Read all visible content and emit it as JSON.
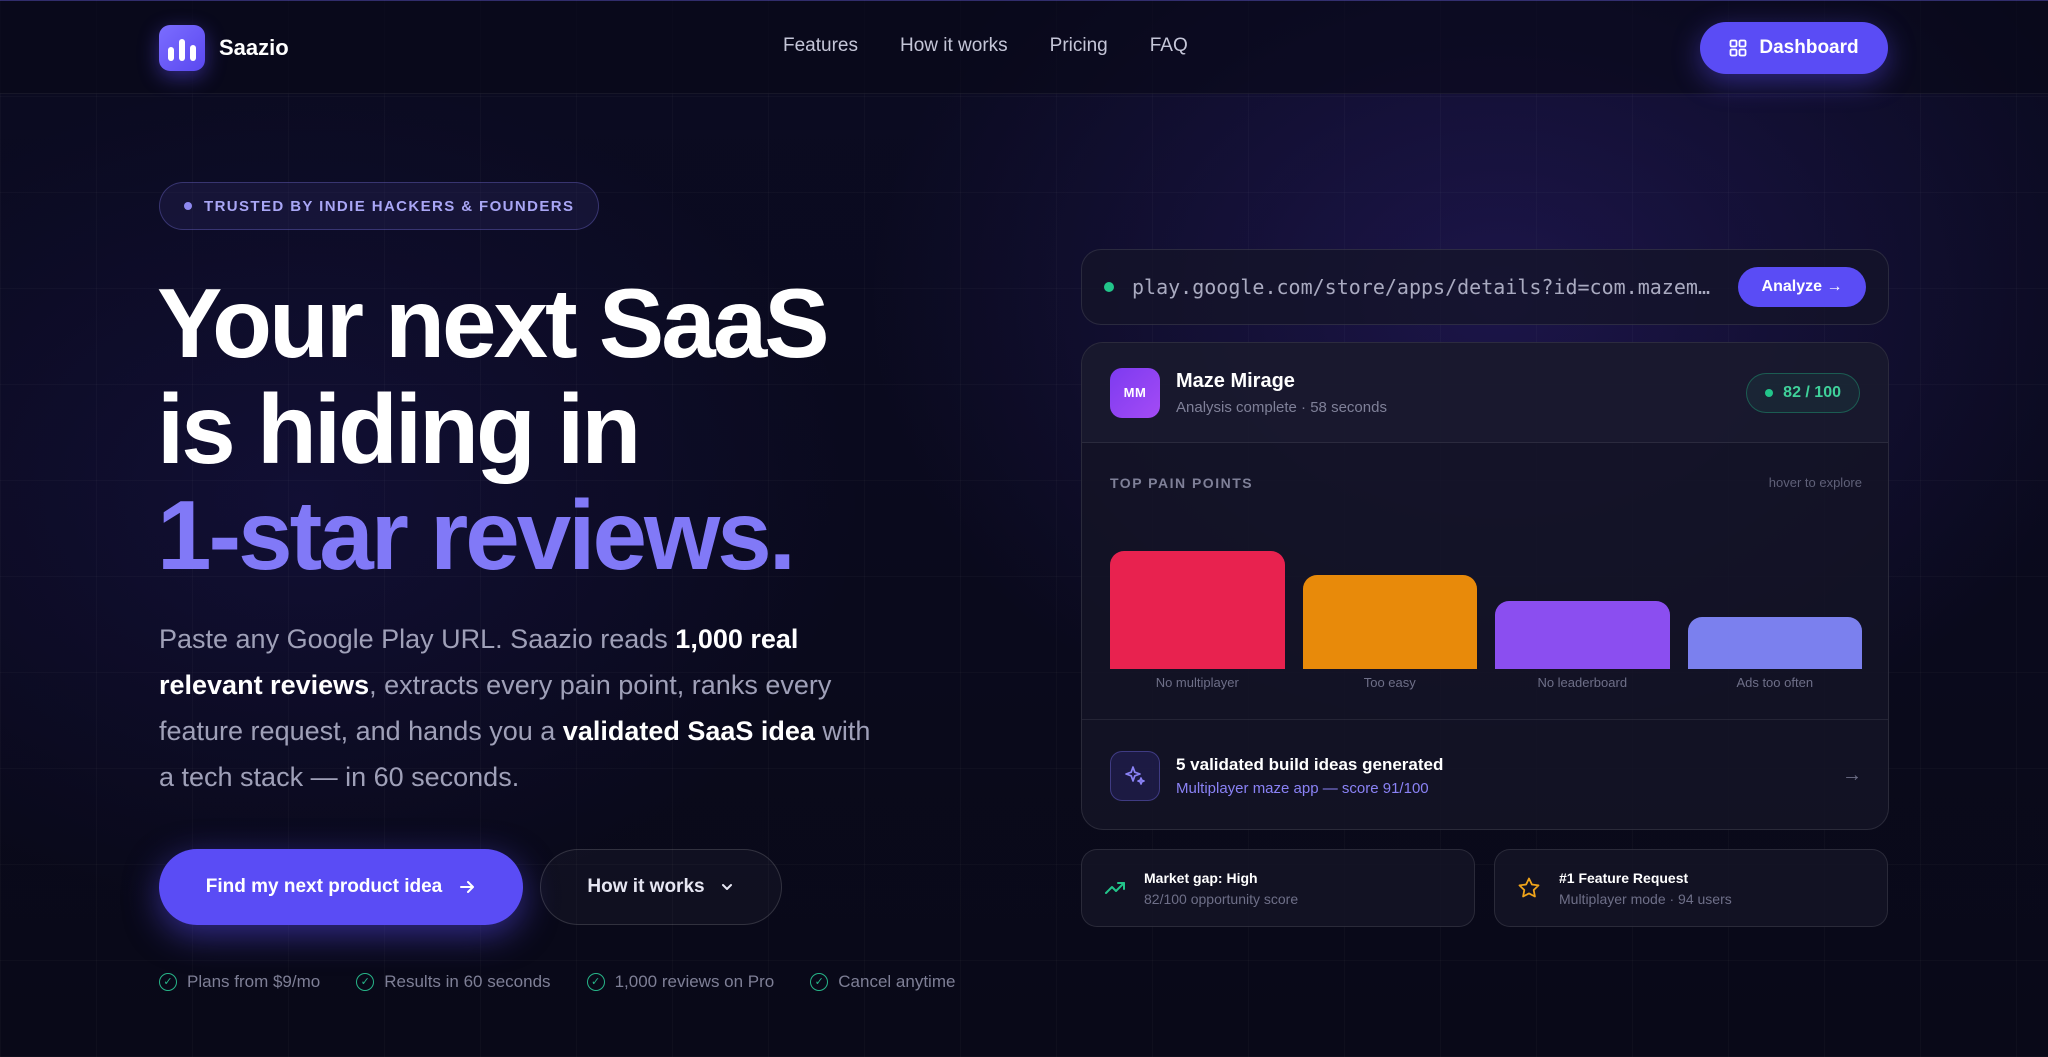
{
  "brand": {
    "name": "Saazio"
  },
  "nav": {
    "links": [
      "Features",
      "How it works",
      "Pricing",
      "FAQ"
    ],
    "dashboard_label": "Dashboard"
  },
  "hero": {
    "badge": "TRUSTED BY INDIE HACKERS & FOUNDERS",
    "headline_line1": "Your next SaaS",
    "headline_line2": "is hiding in",
    "headline_accent": "1-star reviews.",
    "sub_part1": "Paste any Google Play URL. Saazio reads ",
    "sub_bold1": "1,000 real relevant reviews",
    "sub_part2": ", extracts every pain point, ranks every feature request, and hands you a ",
    "sub_bold2": "validated SaaS idea",
    "sub_part3": " with a tech stack — in 60 seconds.",
    "cta_primary": "Find my next product idea",
    "cta_secondary": "How it works",
    "perks": [
      "Plans from $9/mo",
      "Results in 60 seconds",
      "1,000 reviews on Pro",
      "Cancel anytime"
    ]
  },
  "analyzer": {
    "url": "play.google.com/store/apps/details?id=com.mazemirage.game",
    "analyze_label": "Analyze →",
    "app_initials": "MM",
    "app_name": "Maze Mirage",
    "app_status": "Analysis complete · 58 seconds",
    "score": "82 / 100",
    "pain_title": "TOP PAIN POINTS",
    "pain_hint": "hover to explore",
    "ideas_title": "5 validated build ideas generated",
    "ideas_sub": "Multiplayer maze app — score 91/100",
    "colors": {
      "accent": "#5a4cf5",
      "success": "#22c58a"
    }
  },
  "chart_data": {
    "type": "bar",
    "categories": [
      "No multiplayer",
      "Too easy",
      "No leaderboard",
      "Ads too often"
    ],
    "values": [
      100,
      80,
      58,
      44
    ],
    "colors": [
      "#e8224f",
      "#e88a0a",
      "#8b4ef0",
      "#7b80ee"
    ],
    "title": "TOP PAIN POINTS",
    "ylim": [
      0,
      100
    ],
    "grid": false
  },
  "stats": {
    "market_title": "Market gap: High",
    "market_sub": "82/100 opportunity score",
    "feature_title": "#1 Feature Request",
    "feature_sub": "Multiplayer mode · 94 users"
  }
}
